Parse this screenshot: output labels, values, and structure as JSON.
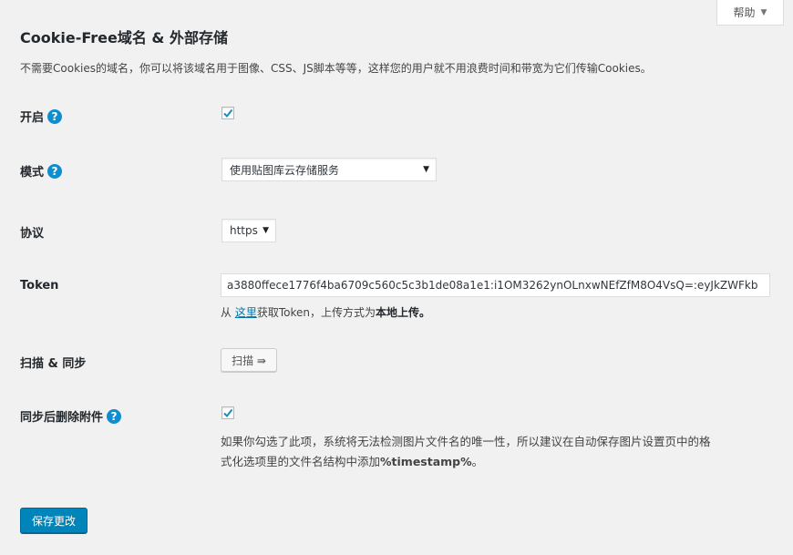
{
  "help_tab": {
    "label": "帮助"
  },
  "page": {
    "title": "Cookie-Free域名 & 外部存储",
    "description": "不需要Cookies的域名，你可以将该域名用于图像、CSS、JS脚本等等，这样您的用户就不用浪费时间和带宽为它们传输Cookies。"
  },
  "fields": {
    "enable": {
      "label": "开启",
      "checked": true
    },
    "mode": {
      "label": "模式",
      "selected": "使用贴图库云存储服务"
    },
    "protocol": {
      "label": "协议",
      "selected": "https"
    },
    "token": {
      "label": "Token",
      "value": "a3880ffece1776f4ba6709c560c5c3b1de08a1e1:i1OM3262ynOLnxwNEfZfM8O4VsQ=:eyJkZWFkb",
      "note_prefix": "从 ",
      "note_link": "这里",
      "note_middle": "获取Token，上传方式为",
      "note_bold": "本地上传。"
    },
    "scan": {
      "label": "扫描 & 同步",
      "button_label": "扫描 ⇛"
    },
    "delete_after_sync": {
      "label": "同步后删除附件",
      "checked": true,
      "note_line1": "如果你勾选了此项，系统将无法检测图片文件名的唯一性，所以建议在自动保存图片设置页中的格",
      "note_line2_prefix": "式化选项里的文件名结构中添加",
      "note_line2_bold": "%timestamp%",
      "note_line2_suffix": "。"
    }
  },
  "save_button": {
    "label": "保存更改"
  },
  "colors": {
    "accent": "#0085ba",
    "help_icon": "#0e8dcf",
    "link": "#0073aa"
  }
}
